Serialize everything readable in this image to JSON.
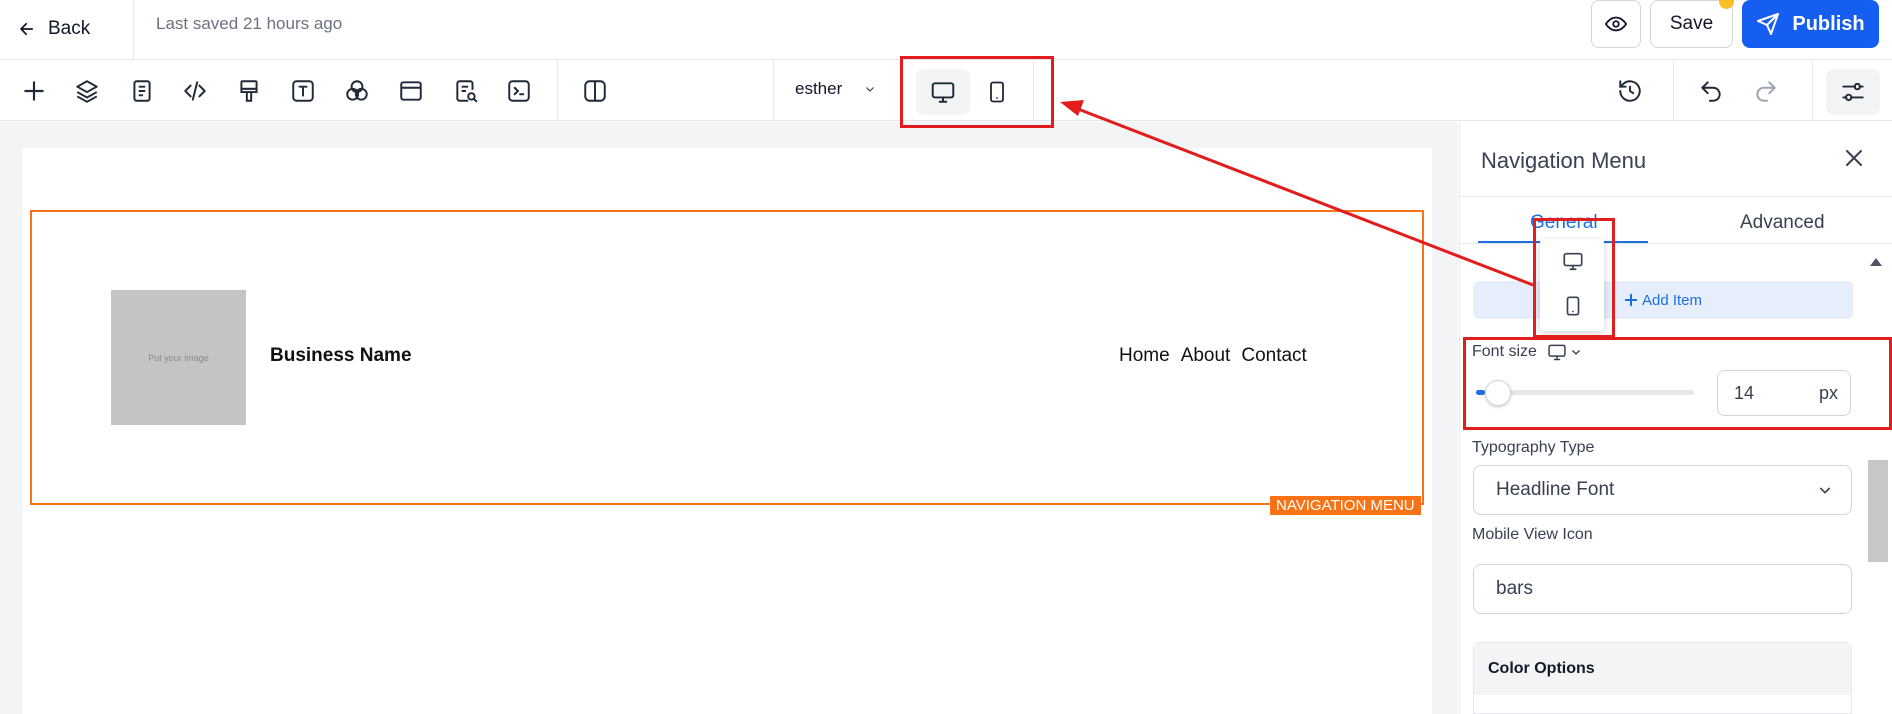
{
  "header": {
    "back_label": "Back",
    "last_saved": "Last saved 21 hours ago",
    "save_label": "Save",
    "publish_label": "Publish"
  },
  "toolbar": {
    "icons": [
      "plus-icon",
      "layers-icon",
      "page-icon",
      "code-icon",
      "paint-roller-icon",
      "text-icon",
      "color-circles-icon",
      "section-icon",
      "page-search-icon",
      "terminal-icon",
      "split-view-icon"
    ],
    "user_name": "esther",
    "device_modes": [
      "desktop",
      "mobile"
    ],
    "active_device": "desktop"
  },
  "canvas": {
    "image_placeholder": "Put your image",
    "business_name": "Business Name",
    "nav_links": [
      "Home",
      "About",
      "Contact"
    ],
    "selected_element_label": "NAVIGATION MENU"
  },
  "panel": {
    "title": "Navigation Menu",
    "tabs": [
      {
        "label": "General",
        "active": true
      },
      {
        "label": "Advanced",
        "active": false
      }
    ],
    "add_item_label": "Add Item",
    "font_size": {
      "label": "Font size",
      "value": "14",
      "unit": "px",
      "slider_fraction": 0.04
    },
    "typography": {
      "label": "Typography Type",
      "value": "Headline Font"
    },
    "mobile_icon": {
      "label": "Mobile View Icon",
      "value": "bars"
    },
    "color_options_label": "Color Options"
  },
  "colors": {
    "accent": "#155eef",
    "selection": "#f97316",
    "annotation": "#e11d1d"
  }
}
